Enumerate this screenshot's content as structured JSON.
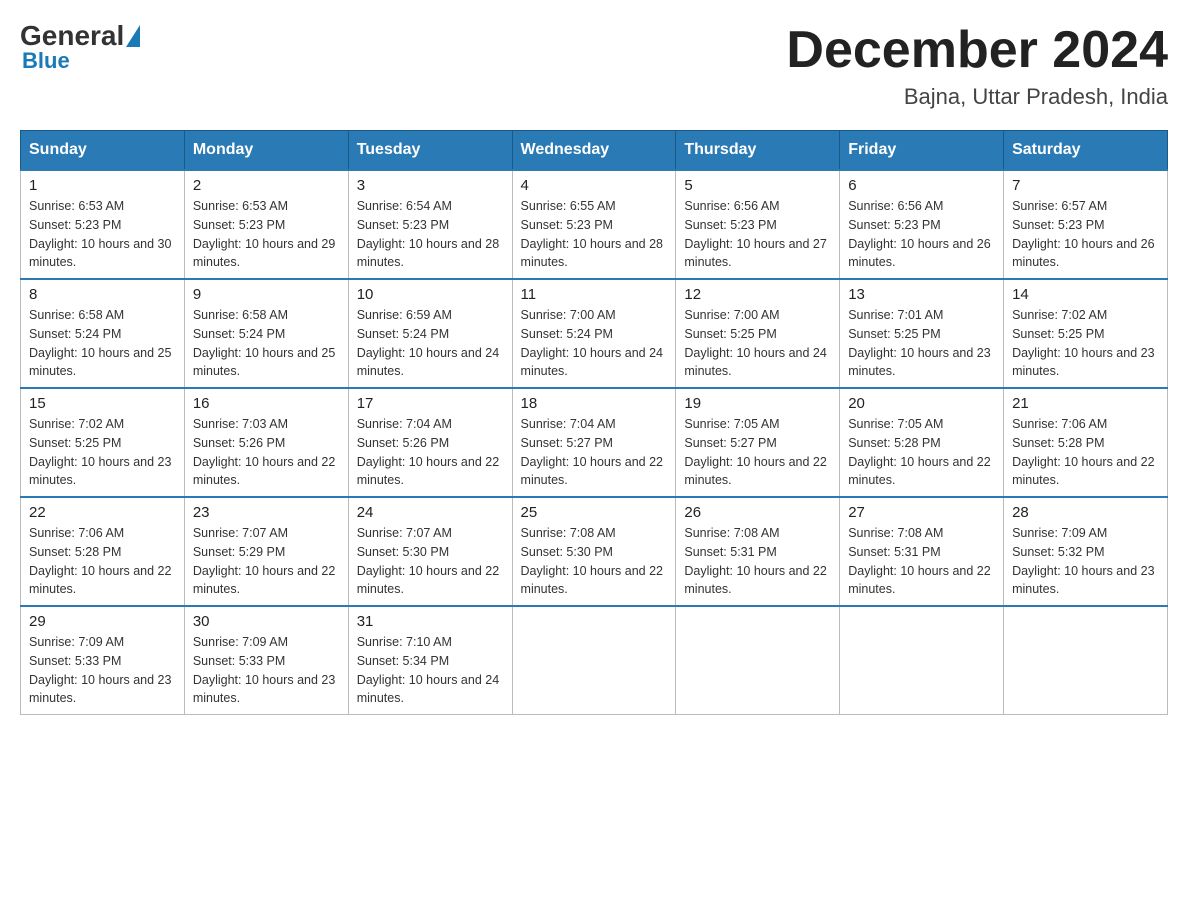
{
  "header": {
    "logo_general": "General",
    "logo_blue": "Blue",
    "month_title": "December 2024",
    "location": "Bajna, Uttar Pradesh, India"
  },
  "days_of_week": [
    "Sunday",
    "Monday",
    "Tuesday",
    "Wednesday",
    "Thursday",
    "Friday",
    "Saturday"
  ],
  "weeks": [
    [
      {
        "day": "1",
        "sunrise": "6:53 AM",
        "sunset": "5:23 PM",
        "daylight": "10 hours and 30 minutes."
      },
      {
        "day": "2",
        "sunrise": "6:53 AM",
        "sunset": "5:23 PM",
        "daylight": "10 hours and 29 minutes."
      },
      {
        "day": "3",
        "sunrise": "6:54 AM",
        "sunset": "5:23 PM",
        "daylight": "10 hours and 28 minutes."
      },
      {
        "day": "4",
        "sunrise": "6:55 AM",
        "sunset": "5:23 PM",
        "daylight": "10 hours and 28 minutes."
      },
      {
        "day": "5",
        "sunrise": "6:56 AM",
        "sunset": "5:23 PM",
        "daylight": "10 hours and 27 minutes."
      },
      {
        "day": "6",
        "sunrise": "6:56 AM",
        "sunset": "5:23 PM",
        "daylight": "10 hours and 26 minutes."
      },
      {
        "day": "7",
        "sunrise": "6:57 AM",
        "sunset": "5:23 PM",
        "daylight": "10 hours and 26 minutes."
      }
    ],
    [
      {
        "day": "8",
        "sunrise": "6:58 AM",
        "sunset": "5:24 PM",
        "daylight": "10 hours and 25 minutes."
      },
      {
        "day": "9",
        "sunrise": "6:58 AM",
        "sunset": "5:24 PM",
        "daylight": "10 hours and 25 minutes."
      },
      {
        "day": "10",
        "sunrise": "6:59 AM",
        "sunset": "5:24 PM",
        "daylight": "10 hours and 24 minutes."
      },
      {
        "day": "11",
        "sunrise": "7:00 AM",
        "sunset": "5:24 PM",
        "daylight": "10 hours and 24 minutes."
      },
      {
        "day": "12",
        "sunrise": "7:00 AM",
        "sunset": "5:25 PM",
        "daylight": "10 hours and 24 minutes."
      },
      {
        "day": "13",
        "sunrise": "7:01 AM",
        "sunset": "5:25 PM",
        "daylight": "10 hours and 23 minutes."
      },
      {
        "day": "14",
        "sunrise": "7:02 AM",
        "sunset": "5:25 PM",
        "daylight": "10 hours and 23 minutes."
      }
    ],
    [
      {
        "day": "15",
        "sunrise": "7:02 AM",
        "sunset": "5:25 PM",
        "daylight": "10 hours and 23 minutes."
      },
      {
        "day": "16",
        "sunrise": "7:03 AM",
        "sunset": "5:26 PM",
        "daylight": "10 hours and 22 minutes."
      },
      {
        "day": "17",
        "sunrise": "7:04 AM",
        "sunset": "5:26 PM",
        "daylight": "10 hours and 22 minutes."
      },
      {
        "day": "18",
        "sunrise": "7:04 AM",
        "sunset": "5:27 PM",
        "daylight": "10 hours and 22 minutes."
      },
      {
        "day": "19",
        "sunrise": "7:05 AM",
        "sunset": "5:27 PM",
        "daylight": "10 hours and 22 minutes."
      },
      {
        "day": "20",
        "sunrise": "7:05 AM",
        "sunset": "5:28 PM",
        "daylight": "10 hours and 22 minutes."
      },
      {
        "day": "21",
        "sunrise": "7:06 AM",
        "sunset": "5:28 PM",
        "daylight": "10 hours and 22 minutes."
      }
    ],
    [
      {
        "day": "22",
        "sunrise": "7:06 AM",
        "sunset": "5:28 PM",
        "daylight": "10 hours and 22 minutes."
      },
      {
        "day": "23",
        "sunrise": "7:07 AM",
        "sunset": "5:29 PM",
        "daylight": "10 hours and 22 minutes."
      },
      {
        "day": "24",
        "sunrise": "7:07 AM",
        "sunset": "5:30 PM",
        "daylight": "10 hours and 22 minutes."
      },
      {
        "day": "25",
        "sunrise": "7:08 AM",
        "sunset": "5:30 PM",
        "daylight": "10 hours and 22 minutes."
      },
      {
        "day": "26",
        "sunrise": "7:08 AM",
        "sunset": "5:31 PM",
        "daylight": "10 hours and 22 minutes."
      },
      {
        "day": "27",
        "sunrise": "7:08 AM",
        "sunset": "5:31 PM",
        "daylight": "10 hours and 22 minutes."
      },
      {
        "day": "28",
        "sunrise": "7:09 AM",
        "sunset": "5:32 PM",
        "daylight": "10 hours and 23 minutes."
      }
    ],
    [
      {
        "day": "29",
        "sunrise": "7:09 AM",
        "sunset": "5:33 PM",
        "daylight": "10 hours and 23 minutes."
      },
      {
        "day": "30",
        "sunrise": "7:09 AM",
        "sunset": "5:33 PM",
        "daylight": "10 hours and 23 minutes."
      },
      {
        "day": "31",
        "sunrise": "7:10 AM",
        "sunset": "5:34 PM",
        "daylight": "10 hours and 24 minutes."
      },
      null,
      null,
      null,
      null
    ]
  ],
  "labels": {
    "sunrise": "Sunrise:",
    "sunset": "Sunset:",
    "daylight": "Daylight:"
  }
}
